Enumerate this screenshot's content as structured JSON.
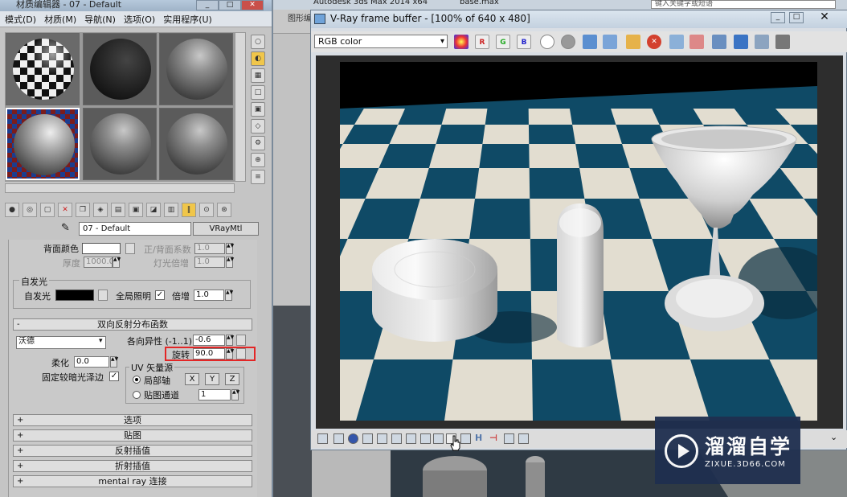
{
  "background_app": {
    "title": "Autodesk 3ds Max  2014 x64",
    "file": "base.max",
    "search_placeholder": "键入关键字或短语",
    "menu_fragment": "图形编"
  },
  "material_editor": {
    "title": "材质编辑器 - 07 - Default",
    "menus": [
      "模式(D)",
      "材质(M)",
      "导航(N)",
      "选项(O)",
      "实用程序(U)"
    ],
    "material_name": "07 - Default",
    "material_type": "VRayMtl",
    "params": {
      "back_color_label": "背面颜色",
      "front_back_coeff_label": "正/背面系数",
      "front_back_coeff_value": "1.0",
      "thickness_label": "厚度",
      "thickness_value": "1000.0",
      "light_mult_label": "灯光倍增",
      "light_mult_value": "1.0",
      "self_illum_group": "自发光",
      "self_illum_label": "自发光",
      "gi_label": "全局照明",
      "gi_check": "✓",
      "mult_label": "倍增",
      "mult_value": "1.0"
    },
    "brdf": {
      "header": "双向反射分布函数",
      "type_value": "沃德",
      "aniso_label": "各向异性 (-1..1)",
      "aniso_value": "-0.6",
      "rotation_label": "旋转",
      "rotation_value": "90.0",
      "soften_label": "柔化",
      "soften_value": "0.0",
      "fix_dark_label": "固定较暗光泽边",
      "fix_dark_check": "✓",
      "uv_group": "UV 矢量源",
      "local_axis_label": "局部轴",
      "map_channel_label": "贴图通道",
      "map_channel_value": "1",
      "x": "X",
      "y": "Y",
      "z": "Z"
    },
    "rollouts": [
      "选项",
      "贴图",
      "反射插值",
      "折射插值",
      "mental ray 连接"
    ]
  },
  "vfb": {
    "title": "V-Ray frame buffer - [100% of 640 x 480]",
    "channel": "RGB color",
    "buttons": [
      "R",
      "G",
      "B"
    ]
  },
  "watermark": {
    "name": "溜溜自学",
    "url": "ZIXUE.3D66.COM"
  },
  "colors": {
    "floor_teal": "#0f4a66",
    "floor_cream": "#e2ddd0",
    "highlight_red": "#e32626"
  }
}
